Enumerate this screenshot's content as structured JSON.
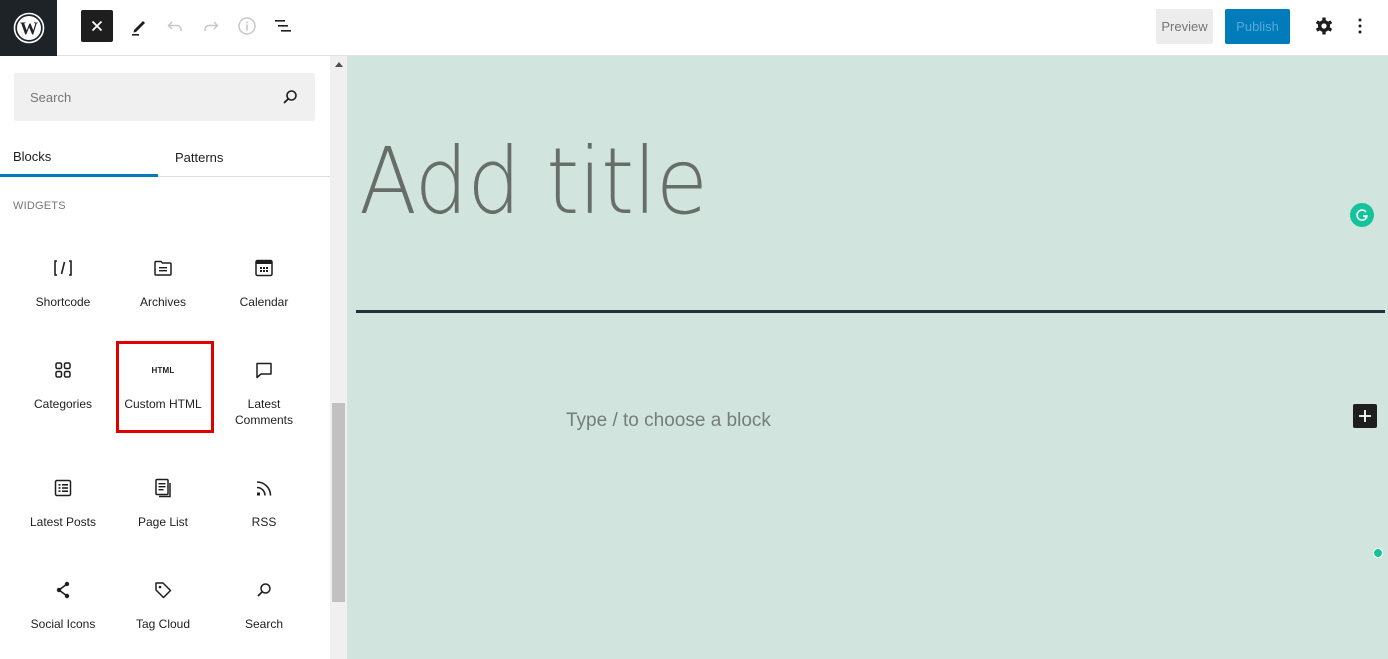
{
  "topbar": {
    "close_label": "Close block inserter",
    "preview_label": "Preview",
    "publish_label": "Publish"
  },
  "colors": {
    "accent": "#007cba",
    "canvas_bg": "#d2e4de",
    "highlight": "#e00000",
    "grammarly": "#15c39a"
  },
  "sidebar": {
    "search": {
      "placeholder": "Search",
      "value": ""
    },
    "tabs": [
      {
        "label": "Blocks",
        "active": true
      },
      {
        "label": "Patterns",
        "active": false
      }
    ],
    "section_title": "WIDGETS",
    "blocks": [
      {
        "label": "Shortcode",
        "icon": "shortcode-icon"
      },
      {
        "label": "Archives",
        "icon": "archives-icon"
      },
      {
        "label": "Calendar",
        "icon": "calendar-icon"
      },
      {
        "label": "Categories",
        "icon": "categories-icon"
      },
      {
        "label": "Custom HTML",
        "icon": "html-icon",
        "icon_text": "HTML",
        "highlighted": true
      },
      {
        "label": "Latest Comments",
        "icon": "comment-icon"
      },
      {
        "label": "Latest Posts",
        "icon": "latest-posts-icon"
      },
      {
        "label": "Page List",
        "icon": "page-list-icon"
      },
      {
        "label": "RSS",
        "icon": "rss-icon"
      },
      {
        "label": "Social Icons",
        "icon": "share-icon"
      },
      {
        "label": "Tag Cloud",
        "icon": "tag-icon"
      },
      {
        "label": "Search",
        "icon": "search-icon"
      }
    ]
  },
  "editor": {
    "title_placeholder": "Add title",
    "block_placeholder": "Type / to choose a block"
  }
}
